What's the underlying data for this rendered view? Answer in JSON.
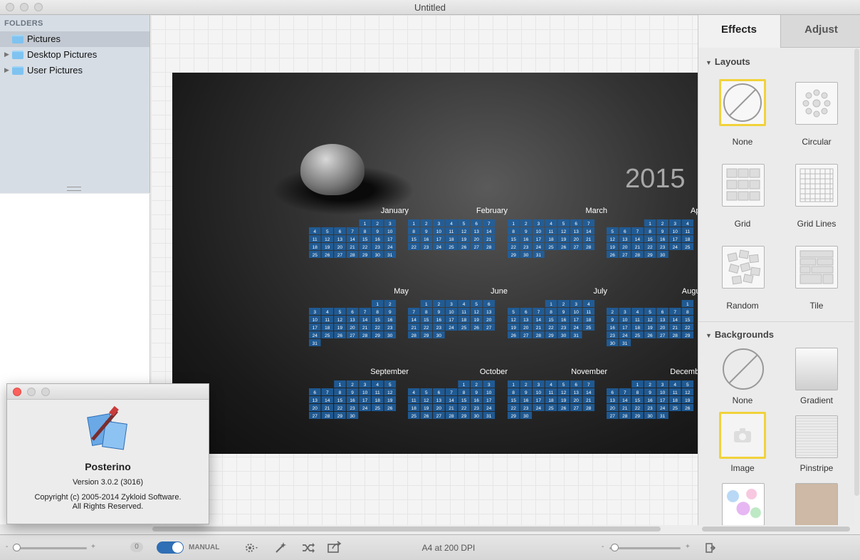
{
  "window": {
    "title": "Untitled"
  },
  "sidebar": {
    "header": "FOLDERS",
    "items": [
      {
        "label": "Pictures",
        "selected": true
      },
      {
        "label": "Desktop Pictures",
        "selected": false
      },
      {
        "label": "User Pictures",
        "selected": false
      }
    ]
  },
  "poster": {
    "year": "2015",
    "months": [
      "January",
      "February",
      "March",
      "April",
      "May",
      "June",
      "July",
      "August",
      "September",
      "October",
      "November",
      "December"
    ]
  },
  "right_panel": {
    "tabs": [
      {
        "label": "Effects",
        "active": true
      },
      {
        "label": "Adjust",
        "active": false
      }
    ],
    "layouts_header": "Layouts",
    "layouts": [
      {
        "label": "None",
        "icon": "none-icon",
        "selected": true
      },
      {
        "label": "Circular",
        "icon": "circular-layout-icon"
      },
      {
        "label": "Grid",
        "icon": "grid-layout-icon"
      },
      {
        "label": "Grid Lines",
        "icon": "grid-lines-layout-icon"
      },
      {
        "label": "Random",
        "icon": "random-layout-icon"
      },
      {
        "label": "Tile",
        "icon": "tile-layout-icon"
      }
    ],
    "backgrounds_header": "Backgrounds",
    "backgrounds": [
      {
        "label": "None",
        "icon": "none-icon"
      },
      {
        "label": "Gradient",
        "icon": "gradient-background-icon"
      },
      {
        "label": "Image",
        "icon": "image-background-icon",
        "selected": true
      },
      {
        "label": "Pinstripe",
        "icon": "pinstripe-background-icon"
      }
    ]
  },
  "bottom_bar": {
    "left_zoom_minus": "-",
    "left_zoom_plus": "+",
    "left_count": "0",
    "mode_label": "MANUAL",
    "paper_info": "A4 at 200 DPI",
    "zoom_minus": "-",
    "zoom_plus": "+"
  },
  "about_dialog": {
    "app_name": "Posterino",
    "version": "Version 3.0.2 (3016)",
    "copyright": "Copyright (c) 2005-2014 Zykloid Software.",
    "rights": "All Rights Reserved."
  },
  "colors": {
    "accent_blue": "#1f5f9f",
    "selection_yellow": "#f1d23a",
    "sidebar_bg": "#d6dde5"
  }
}
